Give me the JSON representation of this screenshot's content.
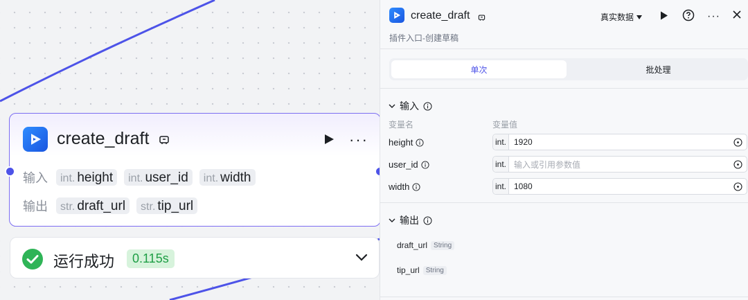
{
  "node": {
    "title": "create_draft",
    "input_label": "输入",
    "output_label": "输出",
    "inputs": [
      {
        "type": "int.",
        "name": "height"
      },
      {
        "type": "int.",
        "name": "user_id"
      },
      {
        "type": "int.",
        "name": "width"
      }
    ],
    "outputs": [
      {
        "type": "str.",
        "name": "draft_url"
      },
      {
        "type": "str.",
        "name": "tip_url"
      }
    ]
  },
  "status": {
    "text": "运行成功",
    "time": "0.115s",
    "color": "#1e9e45"
  },
  "panel": {
    "title": "create_draft",
    "subtitle": "插件入口-创建草稿",
    "mode": "真实数据",
    "tabs": [
      "单次",
      "批处理"
    ],
    "input_section": "输入",
    "col_name": "变量名",
    "col_value": "变量值",
    "variables": [
      {
        "name": "height",
        "type": "int.",
        "value": "1920",
        "placeholder": ""
      },
      {
        "name": "user_id",
        "type": "int.",
        "value": "",
        "placeholder": "输入或引用参数值"
      },
      {
        "name": "width",
        "type": "int.",
        "value": "1080",
        "placeholder": ""
      }
    ],
    "output_section": "输出",
    "outputs": [
      {
        "name": "draft_url",
        "type": "String"
      },
      {
        "name": "tip_url",
        "type": "String"
      }
    ]
  },
  "colors": {
    "accent": "#4d53e8",
    "node_border": "#7c6df2",
    "success": "#2fb457"
  }
}
